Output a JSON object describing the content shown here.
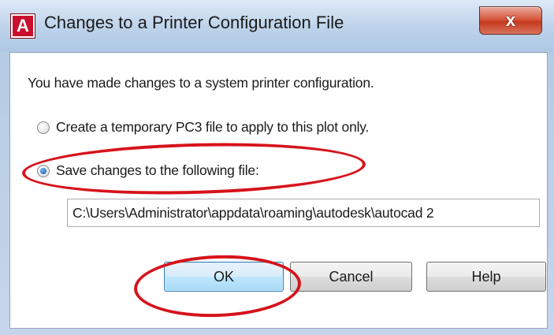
{
  "window": {
    "title": "Changes to a Printer Configuration File",
    "app_icon_letter": "A",
    "close_glyph": "x"
  },
  "dialog": {
    "message": "You have made changes to a system printer configuration.",
    "options": [
      {
        "label": "Create a temporary PC3 file to apply to this plot only.",
        "checked": false
      },
      {
        "label": "Save changes to the following file:",
        "checked": true
      }
    ],
    "file_path": "C:\\Users\\Administrator\\appdata\\roaming\\autodesk\\autocad 2"
  },
  "buttons": {
    "ok": "OK",
    "cancel": "Cancel",
    "help": "Help"
  },
  "annotation_color": "#d6131b"
}
